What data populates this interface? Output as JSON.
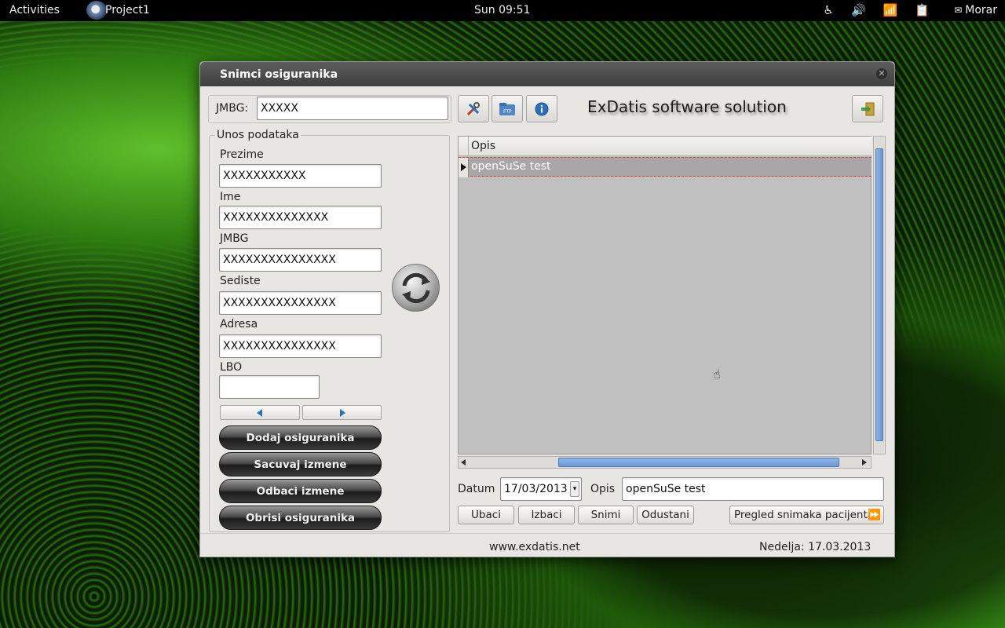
{
  "topbar": {
    "activities": "Activities",
    "app_name": "Project1",
    "clock": "Sun 09:51",
    "icons": [
      "accessibility-icon",
      "volume-icon",
      "wifi-icon",
      "clipboard-icon"
    ],
    "user": "Morar"
  },
  "window": {
    "title": "Snimci osiguranika",
    "jmbg_label": "JMBG:",
    "jmbg_value": "XXXXX",
    "brand": "ExDatis software solution",
    "group_title": "Unos podataka",
    "fields": {
      "prezime_label": "Prezime",
      "prezime_value": "XXXXXXXXXXX",
      "ime_label": "Ime",
      "ime_value": "XXXXXXXXXXXXXX",
      "jmbg_label": "JMBG",
      "jmbg_value": "XXXXXXXXXXXXXXX",
      "sediste_label": "Sediste",
      "sediste_value": "XXXXXXXXXXXXXXX",
      "adresa_label": "Adresa",
      "adresa_value": "XXXXXXXXXXXXXXX",
      "lbo_label": "LBO",
      "lbo_value": ""
    },
    "actions": {
      "add": "Dodaj osiguranika",
      "save": "Sacuvaj izmene",
      "discard": "Odbaci izmene",
      "delete": "Obrisi osiguranika"
    },
    "grid": {
      "column": "Opis",
      "rows": [
        "openSuSe test"
      ]
    },
    "bottom": {
      "datum_label": "Datum",
      "datum_value": "17/03/2013",
      "opis_label": "Opis",
      "opis_value": "openSuSe test",
      "ubaci": "Ubaci",
      "izbaci": "Izbaci",
      "snimi": "Snimi",
      "odustani": "Odustani",
      "pregled": "Pregled snimaka pacijenta"
    },
    "status": {
      "website": "www.exdatis.net",
      "date": "Nedelja: 17.03.2013"
    }
  }
}
